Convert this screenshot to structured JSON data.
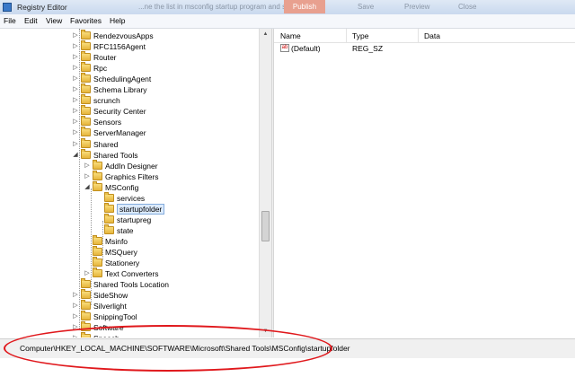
{
  "window": {
    "title": "Registry Editor",
    "background_text": "...ne the list in msconfig startup program and services",
    "background_button_red": "Publish",
    "background_buttons": [
      "Save",
      "Preview",
      "Close"
    ]
  },
  "menu": [
    "File",
    "Edit",
    "View",
    "Favorites",
    "Help"
  ],
  "tree": {
    "items": [
      {
        "label": "RendezvousApps",
        "expander": "▷",
        "indent": 0
      },
      {
        "label": "RFC1156Agent",
        "expander": "▷",
        "indent": 0
      },
      {
        "label": "Router",
        "expander": "▷",
        "indent": 0
      },
      {
        "label": "Rpc",
        "expander": "▷",
        "indent": 0
      },
      {
        "label": "SchedulingAgent",
        "expander": "▷",
        "indent": 0
      },
      {
        "label": "Schema Library",
        "expander": "▷",
        "indent": 0
      },
      {
        "label": "scrunch",
        "expander": "▷",
        "indent": 0
      },
      {
        "label": "Security Center",
        "expander": "▷",
        "indent": 0
      },
      {
        "label": "Sensors",
        "expander": "▷",
        "indent": 0
      },
      {
        "label": "ServerManager",
        "expander": "▷",
        "indent": 0
      },
      {
        "label": "Shared",
        "expander": "▷",
        "indent": 0
      },
      {
        "label": "Shared Tools",
        "expander": "◢",
        "indent": 0
      },
      {
        "label": "AddIn Designer",
        "expander": "▷",
        "indent": 1
      },
      {
        "label": "Graphics Filters",
        "expander": "▷",
        "indent": 1
      },
      {
        "label": "MSConfig",
        "expander": "◢",
        "indent": 1
      },
      {
        "label": "services",
        "expander": "",
        "indent": 2
      },
      {
        "label": "startupfolder",
        "expander": "",
        "indent": 2,
        "selected": true
      },
      {
        "label": "startupreg",
        "expander": "",
        "indent": 2
      },
      {
        "label": "state",
        "expander": "",
        "indent": 2
      },
      {
        "label": "Msinfo",
        "expander": "",
        "indent": 1
      },
      {
        "label": "MSQuery",
        "expander": "",
        "indent": 1
      },
      {
        "label": "Stationery",
        "expander": "",
        "indent": 1
      },
      {
        "label": "Text Converters",
        "expander": "▷",
        "indent": 1
      },
      {
        "label": "Shared Tools Location",
        "expander": "",
        "indent": 0
      },
      {
        "label": "SideShow",
        "expander": "▷",
        "indent": 0
      },
      {
        "label": "Silverlight",
        "expander": "▷",
        "indent": 0
      },
      {
        "label": "SnippingTool",
        "expander": "▷",
        "indent": 0
      },
      {
        "label": "Software",
        "expander": "▷",
        "indent": 0
      },
      {
        "label": "Speech",
        "expander": "▷",
        "indent": 0
      }
    ]
  },
  "list": {
    "headers": [
      "Name",
      "Type",
      "Data"
    ],
    "rows": [
      {
        "icon": "ab",
        "name": "(Default)",
        "type": "REG_SZ",
        "data": ""
      }
    ]
  },
  "status": {
    "path": "Computer\\HKEY_LOCAL_MACHINE\\SOFTWARE\\Microsoft\\Shared Tools\\MSConfig\\startupfolder"
  },
  "colors": {
    "annotation": "#e0181c",
    "selection": "#dbeafc"
  }
}
